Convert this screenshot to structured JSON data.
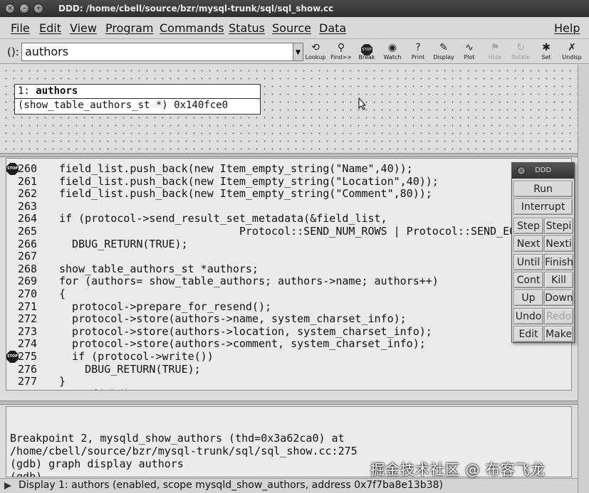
{
  "window": {
    "title": "DDD: /home/cbell/source/bzr/mysql-trunk/sql/sql_show.cc"
  },
  "menubar": {
    "items": [
      "File",
      "Edit",
      "View",
      "Program",
      "Commands",
      "Status",
      "Source",
      "Data"
    ],
    "help": "Help"
  },
  "toolbar": {
    "arg_label": "():",
    "arg_value": "authors",
    "tools": [
      {
        "label": "Lookup",
        "icon": "lookup-icon",
        "enabled": true
      },
      {
        "label": "Find>>",
        "icon": "find-icon",
        "enabled": true
      },
      {
        "label": "Break",
        "icon": "stop-icon",
        "enabled": true
      },
      {
        "label": "Watch",
        "icon": "watch-icon",
        "enabled": true
      },
      {
        "label": "Print",
        "icon": "print-icon",
        "enabled": true
      },
      {
        "label": "Display",
        "icon": "display-icon",
        "enabled": true
      },
      {
        "label": "Plot",
        "icon": "plot-icon",
        "enabled": true
      },
      {
        "label": "Hide",
        "icon": "hide-icon",
        "enabled": false
      },
      {
        "label": "Rotate",
        "icon": "rotate-icon",
        "enabled": false
      },
      {
        "label": "Set",
        "icon": "set-icon",
        "enabled": true
      },
      {
        "label": "Undisp",
        "icon": "undisp-icon",
        "enabled": true
      }
    ]
  },
  "data_display": {
    "number": "1:",
    "name": "authors",
    "value": "(show_table_authors_st *) 0x140fce0"
  },
  "source": {
    "lines": [
      {
        "num": "260",
        "code": "field_list.push_back(new Item_empty_string(\"Name\",40));",
        "breakpoint": true,
        "current": false
      },
      {
        "num": "261",
        "code": "field_list.push_back(new Item_empty_string(\"Location\",40));",
        "breakpoint": false,
        "current": false
      },
      {
        "num": "262",
        "code": "field_list.push_back(new Item_empty_string(\"Comment\",80));",
        "breakpoint": false,
        "current": false
      },
      {
        "num": "263",
        "code": "",
        "breakpoint": false,
        "current": false
      },
      {
        "num": "264",
        "code": "if (protocol->send_result_set_metadata(&field_list,",
        "breakpoint": false,
        "current": false
      },
      {
        "num": "265",
        "code": "                            Protocol::SEND_NUM_ROWS | Protocol::SEND_EOF))",
        "breakpoint": false,
        "current": false
      },
      {
        "num": "266",
        "code": "  DBUG_RETURN(TRUE);",
        "breakpoint": false,
        "current": false
      },
      {
        "num": "267",
        "code": "",
        "breakpoint": false,
        "current": false
      },
      {
        "num": "268",
        "code": "show_table_authors_st *authors;",
        "breakpoint": false,
        "current": false
      },
      {
        "num": "269",
        "code": "for (authors= show_table_authors; authors->name; authors++)",
        "breakpoint": false,
        "current": false
      },
      {
        "num": "270",
        "code": "{",
        "breakpoint": false,
        "current": false
      },
      {
        "num": "271",
        "code": "  protocol->prepare_for_resend();",
        "breakpoint": false,
        "current": false
      },
      {
        "num": "272",
        "code": "  protocol->store(authors->name, system_charset_info);",
        "breakpoint": false,
        "current": false
      },
      {
        "num": "273",
        "code": "  protocol->store(authors->location, system_charset_info);",
        "breakpoint": false,
        "current": false
      },
      {
        "num": "274",
        "code": "  protocol->store(authors->comment, system_charset_info);",
        "breakpoint": false,
        "current": false
      },
      {
        "num": "275",
        "code": "  if (protocol->write())",
        "breakpoint": true,
        "current": true
      },
      {
        "num": "276",
        "code": "    DBUG_RETURN(TRUE);",
        "breakpoint": false,
        "current": false
      },
      {
        "num": "277",
        "code": "}",
        "breakpoint": false,
        "current": false
      },
      {
        "num": "278",
        "code": "my_eof(thd);",
        "breakpoint": false,
        "current": false
      }
    ],
    "stop_glyph": "STOP"
  },
  "console": {
    "lines": [
      "Breakpoint 2, mysqld_show_authors (thd=0x3a62ca0) at",
      "/home/cbell/source/bzr/mysql-trunk/sql/sql_show.cc:275",
      "(gdb) graph display authors",
      "(gdb) "
    ]
  },
  "statusbar": {
    "text": "Display 1: authors (enabled, scope mysqld_show_authors, address 0x7f7ba8e13b38)"
  },
  "command_tool": {
    "title": "DDD",
    "run": "Run",
    "interrupt": "Interrupt",
    "pairs": [
      {
        "left": "Step",
        "right": "Stepi",
        "right_enabled": true
      },
      {
        "left": "Next",
        "right": "Nexti",
        "right_enabled": true
      },
      {
        "left": "Until",
        "right": "Finish",
        "right_enabled": true
      },
      {
        "left": "Cont",
        "right": "Kill",
        "right_enabled": true
      },
      {
        "left": "Up",
        "right": "Down",
        "right_enabled": true
      },
      {
        "left": "Undo",
        "right": "Redo",
        "right_enabled": false
      },
      {
        "left": "Edit",
        "right": "Make",
        "right_enabled": true
      }
    ]
  },
  "watermark": "掘金技术社区 @ 布客飞龙",
  "colors": {
    "titlebar": "#3a3a3a",
    "background": "#dcdcdc",
    "source_bg": "#ebebeb",
    "breakpoint": "#1c1c1c"
  }
}
